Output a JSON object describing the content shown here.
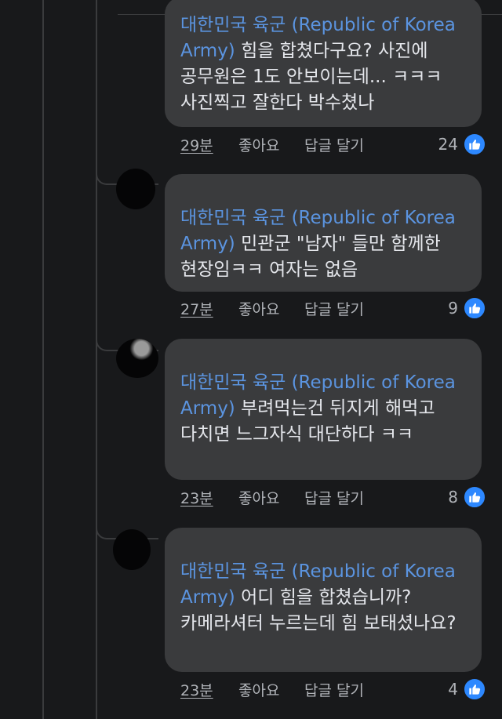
{
  "comments": [
    {
      "mention": "대한민국 육군 (Republic of Korea Army)",
      "text": " 힘을 합쳤다구요? 사진에 공무원은 1도 안보이는데... ㅋㅋㅋ 사진찍고 잘한다 박수쳤나",
      "time": "29분",
      "like_label": "좋아요",
      "reply_label": "답글 달기",
      "like_count": "24"
    },
    {
      "mention": "대한민국 육군 (Republic of Korea Army)",
      "text": " 민관군 \"남자\" 들만 함께한 현장임ㅋㅋ 여자는 없음",
      "time": "27분",
      "like_label": "좋아요",
      "reply_label": "답글 달기",
      "like_count": "9"
    },
    {
      "mention": "대한민국 육군 (Republic of Korea Army)",
      "text": " 부려먹는건 뒤지게 해먹고 다치면 느그자식 대단하다 ㅋㅋ",
      "time": "23분",
      "like_label": "좋아요",
      "reply_label": "답글 달기",
      "like_count": "8"
    },
    {
      "mention": "대한민국 육군 (Republic of Korea Army)",
      "text": " 어디 힘을 합쳤습니까? 카메라셔터 누르는데 힘 보태셨나요?",
      "time": "23분",
      "like_label": "좋아요",
      "reply_label": "답글 달기",
      "like_count": "4"
    }
  ],
  "colors": {
    "background": "#18191b",
    "bubble": "#3a3b3d",
    "mention": "#5b94e0",
    "like_badge": "#2d88ff",
    "meta_text": "#b0b3b8"
  },
  "icons": {
    "like": "thumbs-up-icon"
  }
}
